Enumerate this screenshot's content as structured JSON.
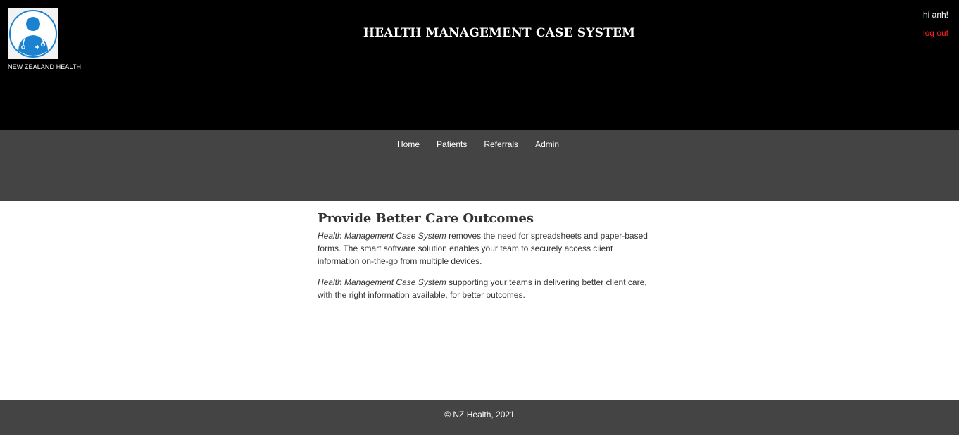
{
  "header": {
    "brand": "NEW ZEALAND HEALTH",
    "title": "HEALTH MANAGEMENT CASE SYSTEM",
    "greeting": "hi anh!",
    "logout_label": "log out",
    "logo_icon": "doctor-avatar-icon"
  },
  "nav": {
    "items": [
      {
        "label": "Home"
      },
      {
        "label": "Patients"
      },
      {
        "label": "Referrals"
      },
      {
        "label": "Admin"
      }
    ]
  },
  "main": {
    "heading": "Provide Better Care Outcomes",
    "para1_em": "Health Management Case System",
    "para1_text": " removes the need for spreadsheets and paper-based forms. The smart software solution enables your team to securely access client information on-the-go from multiple devices.",
    "para2_em": "Health Management Case System",
    "para2_text": " supporting your teams in delivering better client care, with the right information available, for better outcomes."
  },
  "footer": {
    "copyright": "© NZ Health, 2021"
  },
  "colors": {
    "header_bg": "#000000",
    "nav_bg": "#444444",
    "logout": "#ff2020",
    "logo_blue": "#1b82d1"
  }
}
